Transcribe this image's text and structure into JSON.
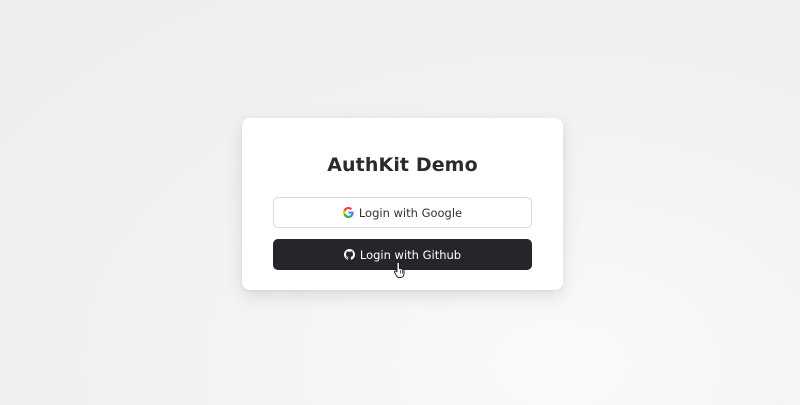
{
  "card": {
    "title": "AuthKit Demo"
  },
  "buttons": {
    "google_label": "Login with Google",
    "github_label": "Login with Github"
  },
  "icons": {
    "google": "google-icon",
    "github": "github-icon",
    "cursor": "hand-pointer-cursor"
  },
  "colors": {
    "github_button_bg": "#24262b",
    "google_button_border": "#d9d9d9",
    "title_text": "#2b2b2b"
  }
}
